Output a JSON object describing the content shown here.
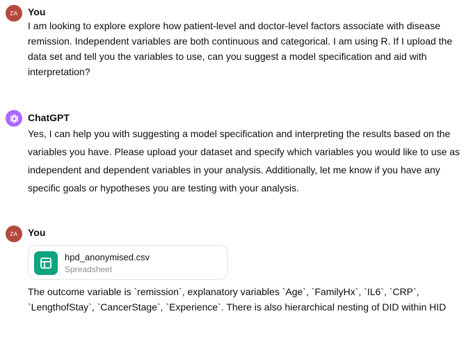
{
  "messages": [
    {
      "author": "You",
      "avatar_initials": "ZA",
      "avatar_color": "#b44a3e",
      "text": "I am looking to explore explore how patient-level and doctor-level factors associate with disease remission. Independent variables are both continuous and categorical. I am using R. If I upload the data set and tell you the variables to use, can you suggest a model specification and aid with interpretation?"
    },
    {
      "author": "ChatGPT",
      "avatar_icon": "openai-logo-icon",
      "avatar_color": "#ab68ff",
      "text": "Yes, I can help you with suggesting a model specification and interpreting the results based on the variables you have. Please upload your dataset and specify which variables you would like to use as independent and dependent variables in your analysis. Additionally, let me know if you have any specific goals or hypotheses you are testing with your analysis."
    },
    {
      "author": "You",
      "avatar_initials": "ZA",
      "avatar_color": "#b44a3e",
      "attachment": {
        "filename": "hpd_anonymised.csv",
        "type": "Spreadsheet",
        "icon": "spreadsheet-icon",
        "icon_color": "#10a37f"
      },
      "text": "The outcome variable is `remission`, explanatory variables `Age`, `FamilyHx`, `IL6`, `CRP`, `LengthofStay`, `CancerStage`, `Experience`. There is also hierarchical nesting of DID within HID"
    }
  ]
}
